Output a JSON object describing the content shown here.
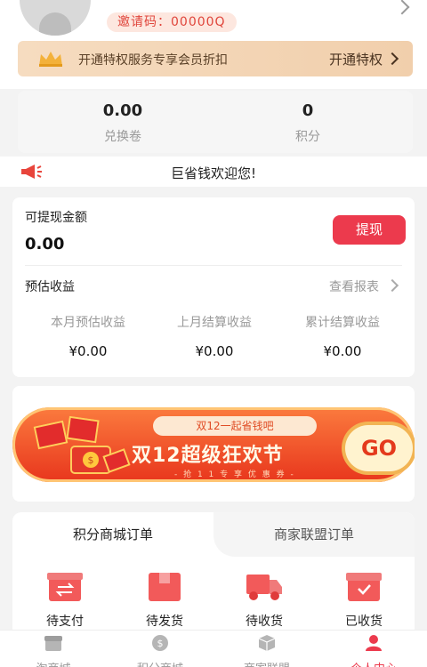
{
  "header": {
    "invite_code": "邀请码：00000Q"
  },
  "vip": {
    "text": "开通特权服务专享会员折扣",
    "button": "开通特权"
  },
  "stats": [
    {
      "value": "0.00",
      "label": "兑换卷"
    },
    {
      "value": "0",
      "label": "积分"
    }
  ],
  "notice": {
    "text": "巨省钱欢迎您!"
  },
  "wallet": {
    "label": "可提现金额",
    "amount": "0.00",
    "button": "提现",
    "estimate_title": "预估收益",
    "report_link": "查看报表",
    "earnings": [
      {
        "label": "本月预估收益",
        "value": "¥0.00"
      },
      {
        "label": "上月结算收益",
        "value": "¥0.00"
      },
      {
        "label": "累计结算收益",
        "value": "¥0.00"
      }
    ]
  },
  "banner": {
    "tag": "双12一起省钱吧",
    "title": "双12超级狂欢节",
    "subtitle": "- 抢 1 1 专 享 优 惠 券 -",
    "go": "GO"
  },
  "orders": {
    "tabs": [
      "积分商城订单",
      "商家联盟订单"
    ],
    "items": [
      {
        "label": "待支付",
        "icon": "pay-icon"
      },
      {
        "label": "待发货",
        "icon": "package-icon"
      },
      {
        "label": "待收货",
        "icon": "truck-icon"
      },
      {
        "label": "已收货",
        "icon": "received-box-icon"
      }
    ]
  },
  "nav": {
    "items": [
      {
        "label": "淘商城",
        "icon": "store-icon"
      },
      {
        "label": "积分商城",
        "icon": "coin-icon"
      },
      {
        "label": "商家联盟",
        "icon": "box-icon"
      },
      {
        "label": "个人中心",
        "icon": "person-icon"
      }
    ]
  },
  "colors": {
    "accent": "#ec3a4d",
    "gold": "#f1cfac"
  }
}
